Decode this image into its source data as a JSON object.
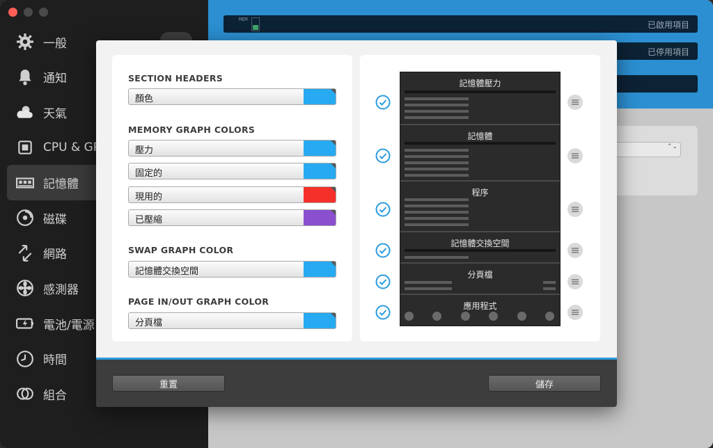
{
  "sidebar": {
    "items": [
      {
        "label": "一般",
        "icon": "gear-icon"
      },
      {
        "label": "通知",
        "icon": "bell-icon"
      },
      {
        "label": "天氣",
        "icon": "weather-icon"
      },
      {
        "label": "CPU & GPU",
        "icon": "cpu-chip-icon"
      },
      {
        "label": "記憶體",
        "icon": "memory-icon",
        "active": true
      },
      {
        "label": "磁碟",
        "icon": "disk-icon"
      },
      {
        "label": "網路",
        "icon": "network-arrows-icon"
      },
      {
        "label": "感測器",
        "icon": "sensor-fan-icon"
      },
      {
        "label": "電池/電源",
        "icon": "battery-icon"
      },
      {
        "label": "時間",
        "icon": "clock-icon"
      },
      {
        "label": "組合",
        "icon": "combine-rings-icon"
      }
    ]
  },
  "background": {
    "mem_tag": "MEM",
    "enabled_label": "已啟用項目",
    "disabled_label": "已停用項目"
  },
  "dialog": {
    "left": {
      "sections": [
        {
          "title": "SECTION HEADERS",
          "rows": [
            {
              "name": "顏色",
              "color": "#27aaf1"
            }
          ]
        },
        {
          "title": "MEMORY GRAPH COLORS",
          "rows": [
            {
              "name": "壓力",
              "color": "#27aaf1"
            },
            {
              "name": "固定的",
              "color": "#27aaf1"
            },
            {
              "name": "現用的",
              "color": "#f5302b"
            },
            {
              "name": "已壓縮",
              "color": "#8a4fcf"
            }
          ]
        },
        {
          "title": "SWAP GRAPH COLOR",
          "rows": [
            {
              "name": "記憶體交換空間",
              "color": "#27aaf1"
            }
          ]
        },
        {
          "title": "PAGE IN/OUT GRAPH COLOR",
          "rows": [
            {
              "name": "分頁檔",
              "color": "#27aaf1"
            }
          ]
        }
      ]
    },
    "right": {
      "sections": [
        {
          "title": "記憶體壓力",
          "checked": true
        },
        {
          "title": "記憶體",
          "checked": true
        },
        {
          "title": "程序",
          "checked": true
        },
        {
          "title": "記憶體交換空間",
          "checked": true
        },
        {
          "title": "分頁檔",
          "checked": true
        },
        {
          "title": "應用程式",
          "checked": true
        }
      ]
    },
    "buttons": {
      "reset": "重置",
      "save": "儲存"
    }
  },
  "colors": {
    "accent": "#2a9bde",
    "check": "#2a9bde",
    "header_blue": "#2b8fd1"
  }
}
